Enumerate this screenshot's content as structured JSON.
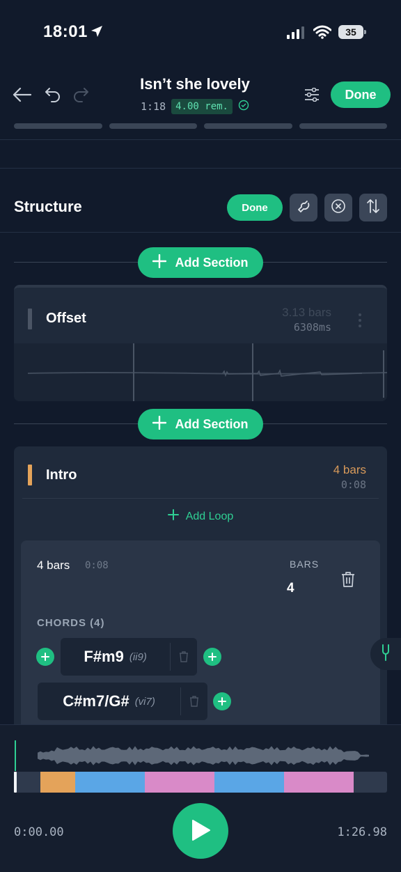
{
  "status_bar": {
    "time": "18:01",
    "battery": "35"
  },
  "header": {
    "title": "Isn’t she lovely",
    "elapsed": "1:18",
    "remaining": "4.00 rem.",
    "done_label": "Done"
  },
  "structure": {
    "title": "Structure",
    "done_label": "Done",
    "add_section_label": "Add Section"
  },
  "offset": {
    "title": "Offset",
    "bars": "3.13 bars",
    "ms": "6308ms"
  },
  "intro": {
    "title": "Intro",
    "bars": "4 bars",
    "time": "0:08",
    "color": "#e4a35a",
    "add_loop_label": "Add Loop",
    "loop": {
      "bars": "4 bars",
      "time": "0:08",
      "bars_label": "BARS",
      "bars_value": "4",
      "chords_label": "CHORDS (4)",
      "chords": [
        {
          "name": "F#m9",
          "roman": "(ii9)"
        },
        {
          "name": "C#m7/G#",
          "roman": "(vi7)"
        }
      ]
    }
  },
  "player": {
    "time_current": "0:00.00",
    "time_total": "1:26.98",
    "timeline_colors": [
      "#2f3a4d",
      "#e4a35a",
      "#5aa6e6",
      "#d98ac8",
      "#5aa6e6",
      "#d98ac8",
      "#2f3a4d"
    ]
  },
  "colors": {
    "accent": "#1fbf82",
    "background": "#111a2b"
  }
}
